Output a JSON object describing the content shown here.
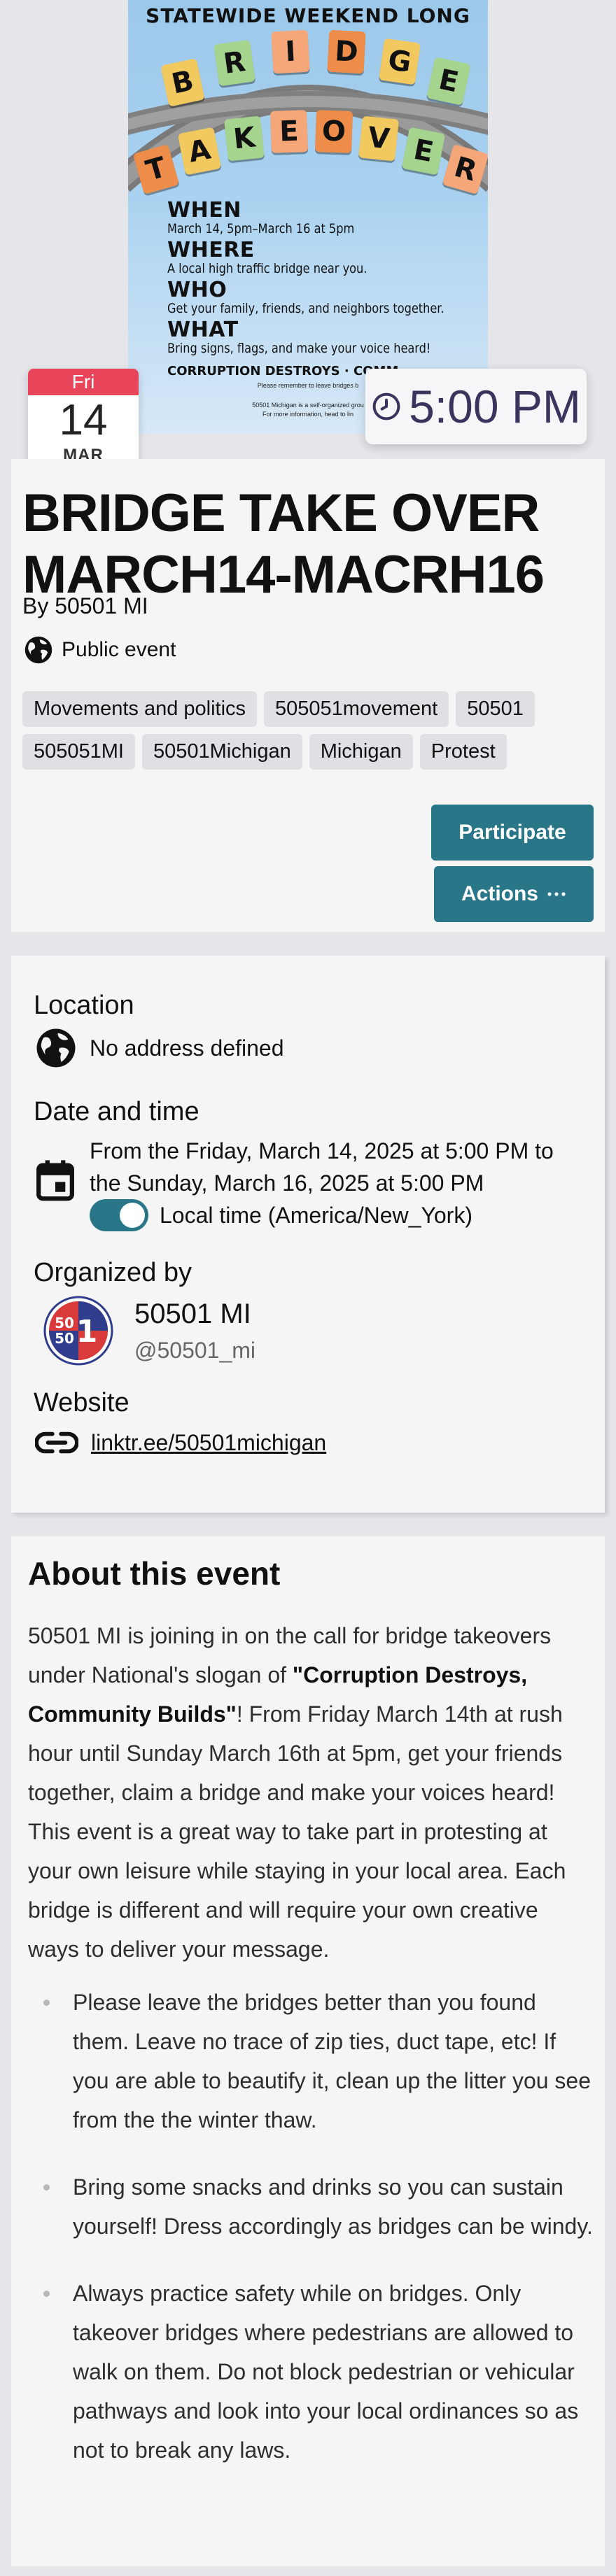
{
  "poster": {
    "banner": "STATEWIDE WEEKEND LONG",
    "word_top": [
      "B",
      "R",
      "I",
      "D",
      "G",
      "E"
    ],
    "word_bottom": [
      "T",
      "A",
      "K",
      "E",
      "O",
      "V",
      "E",
      "R"
    ],
    "when_label": "WHEN",
    "when_text": "March 14, 5pm–March 16 at 5pm",
    "where_label": "WHERE",
    "where_text": "A local high traffic bridge near you.",
    "who_label": "WHO",
    "who_text": "Get your family, friends, and neighbors together.",
    "what_label": "WHAT",
    "what_text": "Bring signs, flags, and make your voice heard!",
    "slogan": "CORRUPTION DESTROYS · COMM",
    "fine_1": "Please remember to leave bridges b",
    "fine_2": "50501 Michigan is a self-organized grou",
    "fine_3": "For more information, head to lin"
  },
  "date_badge": {
    "weekday": "Fri",
    "day": "14",
    "month": "MAR"
  },
  "time_badge": {
    "icon": "clock-icon",
    "time": "5:00 PM"
  },
  "header": {
    "title": "BRIDGE TAKE OVER MARCH14-MACRH16",
    "byline": "By 50501 MI",
    "visibility_icon": "globe-icon",
    "visibility": "Public event",
    "tags": [
      "Movements and politics",
      "505051movement",
      "50501",
      "505051MI",
      "50501Michigan",
      "Michigan",
      "Protest"
    ],
    "participate_label": "Participate",
    "actions_label": "Actions",
    "actions_icon": "more-horizontal-icon"
  },
  "info": {
    "location_heading": "Location",
    "location_value": "No address defined",
    "date_heading": "Date and time",
    "date_line_1": "From the Friday, March 14, 2025 at 5:00 PM to",
    "date_line_2": "the Sunday, March 16, 2025 at 5:00 PM",
    "local_time_label": "Local time (America/New_York)",
    "local_time_on": true,
    "organizer_heading": "Organized by",
    "organizer_avatar_text_1": "50",
    "organizer_avatar_text_2": "50",
    "organizer_avatar_text_3": "1",
    "organizer_name": "50501 MI",
    "organizer_handle": "@50501_mi",
    "website_heading": "Website",
    "website_link": "linktr.ee/50501michigan"
  },
  "about": {
    "heading": "About this event",
    "p_before": "50501 MI is joining in on the call for bridge takeovers under National's slogan of ",
    "p_bold": "\"Corruption Destroys, Community Builds\"",
    "p_after": "! From Friday March 14th at rush hour until Sunday March 16th at 5pm, get your friends together, claim a bridge and make your voices heard! This event is a great way to take part in protesting at your own leisure while staying in your local area. Each bridge is different and will require your own creative ways to deliver your message.",
    "bullets": [
      "Please leave the bridges better than you found them. Leave no trace of zip ties, duct tape, etc! If you are able to beautify it, clean up the litter you see from the the winter thaw.",
      "Bring some snacks and drinks so you can sustain yourself! Dress accordingly as bridges can be windy.",
      "Always practice safety while on bridges. Only takeover bridges where pedestrians are allowed to walk on them. Do not block pedestrian or vehicular pathways and look into your local ordinances so as not to break any laws."
    ]
  },
  "colors": {
    "accent": "#2a7689",
    "date_red": "#e8445a",
    "time_text": "#3a355e",
    "tile_orange": "#ee8d4a",
    "tile_yellow": "#f2c95e",
    "tile_green": "#a5d48e",
    "tile_peach": "#f6a77a"
  }
}
